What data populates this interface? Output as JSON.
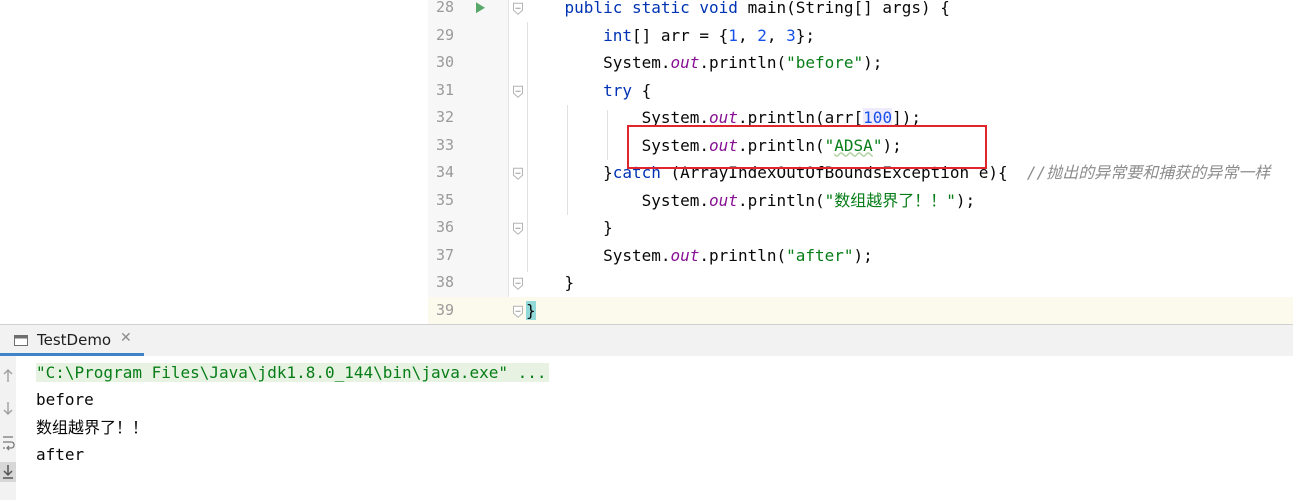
{
  "editor": {
    "lines": [
      {
        "num": "28",
        "tokens": [
          {
            "t": "    "
          },
          {
            "t": "public static void ",
            "c": "kw"
          },
          {
            "t": "main(String[] args) {"
          }
        ]
      },
      {
        "num": "29",
        "tokens": [
          {
            "t": "        "
          },
          {
            "t": "int",
            "c": "kw"
          },
          {
            "t": "[] arr = {"
          },
          {
            "t": "1",
            "c": "num"
          },
          {
            "t": ", "
          },
          {
            "t": "2",
            "c": "num"
          },
          {
            "t": ", "
          },
          {
            "t": "3",
            "c": "num"
          },
          {
            "t": "};"
          }
        ]
      },
      {
        "num": "30",
        "tokens": [
          {
            "t": "        System."
          },
          {
            "t": "out",
            "c": "fld"
          },
          {
            "t": ".println("
          },
          {
            "t": "\"before\"",
            "c": "str"
          },
          {
            "t": ");"
          }
        ]
      },
      {
        "num": "31",
        "tokens": [
          {
            "t": "        "
          },
          {
            "t": "try",
            "c": "kw"
          },
          {
            "t": " {"
          }
        ]
      },
      {
        "num": "32",
        "tokens": [
          {
            "t": "            System."
          },
          {
            "t": "out",
            "c": "fld"
          },
          {
            "t": ".println(arr["
          },
          {
            "t": "100",
            "c": "num hl-bg"
          },
          {
            "t": "]);"
          }
        ]
      },
      {
        "num": "33",
        "tokens": [
          {
            "t": "            System."
          },
          {
            "t": "out",
            "c": "fld"
          },
          {
            "t": ".println("
          },
          {
            "t": "\"",
            "c": "str"
          },
          {
            "t": "ADSA",
            "c": "str squiggle"
          },
          {
            "t": "\"",
            "c": "str"
          },
          {
            "t": ");"
          }
        ]
      },
      {
        "num": "34",
        "tokens": [
          {
            "t": "        }"
          },
          {
            "t": "catch",
            "c": "kw"
          },
          {
            "t": " (ArrayIndexOutOfBoundsException e){  "
          },
          {
            "t": "//抛出的异常要和捕获的异常一样",
            "c": "cmt"
          }
        ]
      },
      {
        "num": "35",
        "tokens": [
          {
            "t": "            System."
          },
          {
            "t": "out",
            "c": "fld"
          },
          {
            "t": ".println("
          },
          {
            "t": "\"数组越界了！！\"",
            "c": "str"
          },
          {
            "t": ");"
          }
        ]
      },
      {
        "num": "36",
        "tokens": [
          {
            "t": "        }"
          }
        ]
      },
      {
        "num": "37",
        "tokens": [
          {
            "t": "        System."
          },
          {
            "t": "out",
            "c": "fld"
          },
          {
            "t": ".println("
          },
          {
            "t": "\"after\"",
            "c": "str"
          },
          {
            "t": ");"
          }
        ]
      },
      {
        "num": "38",
        "tokens": [
          {
            "t": "    }"
          }
        ]
      },
      {
        "num": "39",
        "tokens": [
          {
            "t": "}",
            "c": "brace-hl"
          }
        ],
        "current": true
      }
    ],
    "folded_lines": [
      "28",
      "31",
      "34",
      "36",
      "38",
      "39"
    ]
  },
  "run_panel": {
    "tab_label": "TestDemo",
    "console_lines": [
      {
        "text": "\"C:\\Program Files\\Java\\jdk1.8.0_144\\bin\\java.exe\" ...",
        "type": "cmd"
      },
      {
        "text": "before"
      },
      {
        "text": "数组越界了！！"
      },
      {
        "text": "after"
      }
    ],
    "toolbar_icons": [
      "arrow-up-icon",
      "arrow-down-icon",
      "soft-wrap-icon",
      "scroll-to-end-icon"
    ]
  },
  "colors": {
    "keyword": "#0033b3",
    "string": "#067d17",
    "number": "#1750eb",
    "static_field": "#871094",
    "comment": "#8c8c8c",
    "annotation_box": "#e0262c",
    "run_icon": "#59a869",
    "tab_underline": "#4083c9"
  }
}
